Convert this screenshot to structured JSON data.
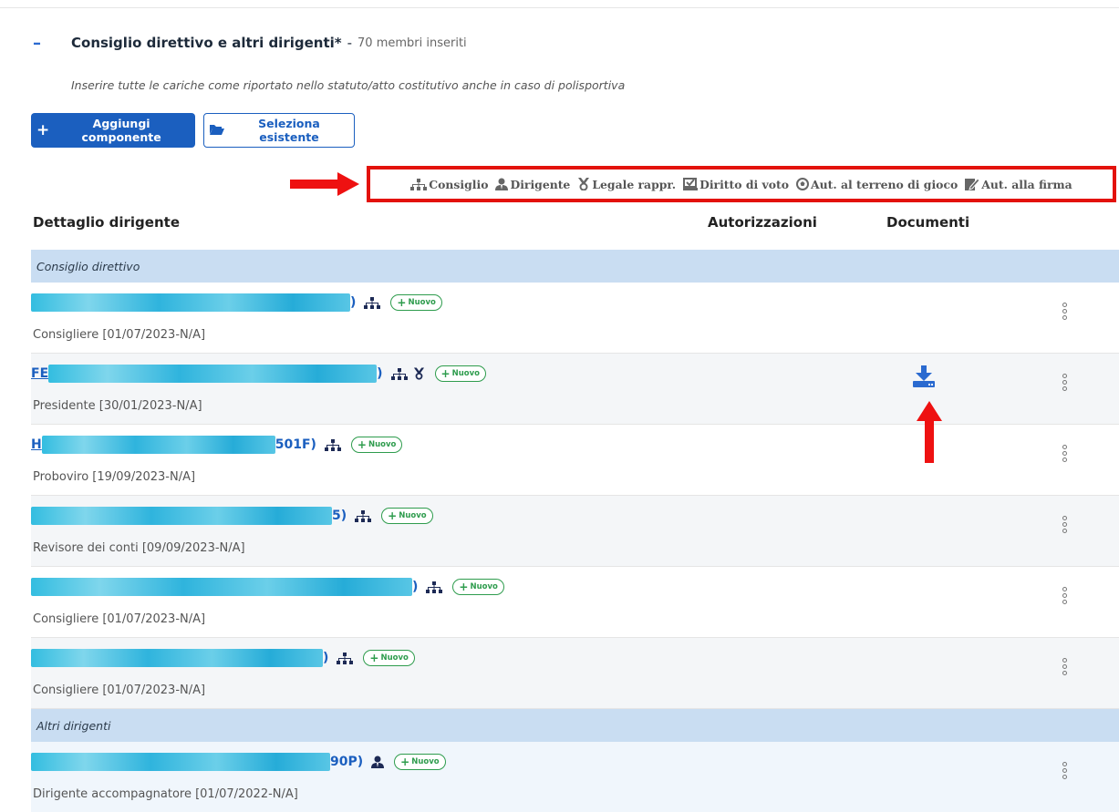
{
  "section": {
    "toggle": "–",
    "title": "Consiglio direttivo e altri dirigenti*",
    "separator": "-",
    "count": "70 membri inseriti",
    "hint": "Inserire tutte le cariche come riportato nello statuto/atto costitutivo anche in caso di polisportiva"
  },
  "buttons": {
    "add_plus": "+",
    "add_label": "Aggiungi componente",
    "select_label": "Seleziona esistente"
  },
  "legend": {
    "items": [
      {
        "icon": "org-chart-icon",
        "label": "Consiglio"
      },
      {
        "icon": "user-tie-icon",
        "label": "Dirigente"
      },
      {
        "icon": "medal-icon",
        "label": "Legale rappr."
      },
      {
        "icon": "vote-box-icon",
        "label": "Diritto di voto"
      },
      {
        "icon": "ball-icon",
        "label": "Aut. al terreno di gioco"
      },
      {
        "icon": "sign-icon",
        "label": "Aut. alla firma"
      }
    ]
  },
  "table": {
    "headers": {
      "detail": "Dettaglio dirigente",
      "authorizations": "Autorizzazioni",
      "documents": "Documenti"
    },
    "groups": [
      {
        "label": "Consiglio direttivo"
      },
      {
        "label": "Altri dirigenti"
      }
    ],
    "rows": [
      {
        "name_prefix": "",
        "name_suffix": ")",
        "role": "Consigliere [01/07/2023-N/A]"
      },
      {
        "name_prefix": "FE",
        "name_suffix": ")",
        "role": "Presidente [30/01/2023-N/A]"
      },
      {
        "name_prefix": "H",
        "name_suffix": "501F)",
        "role": "Proboviro [19/09/2023-N/A]"
      },
      {
        "name_prefix": "",
        "name_suffix": "5)",
        "role": "Revisore dei conti [09/09/2023-N/A]"
      },
      {
        "name_prefix": "",
        "name_suffix": ")",
        "role": "Consigliere [01/07/2023-N/A]"
      },
      {
        "name_prefix": "",
        "name_suffix": ")",
        "role": "Consigliere [01/07/2023-N/A]"
      },
      {
        "name_prefix": "",
        "name_suffix": "90P)",
        "role": "Dirigente accompagnatore [01/07/2022-N/A]"
      }
    ],
    "badge_label": "Nuovo",
    "badge_plus": "+"
  },
  "colors": {
    "primary": "#1b5fbf",
    "group_bg": "#c9ddf2",
    "badge": "#2e9c4d",
    "highlight": "#e3120b",
    "redaction": "#33bde0"
  }
}
